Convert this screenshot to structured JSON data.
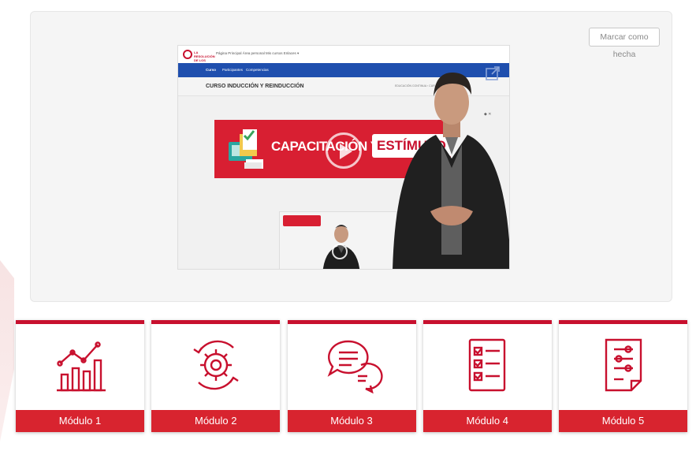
{
  "card": {
    "mark_done_label": "Marcar como hecha"
  },
  "video": {
    "logo_text": "LA RESOLUCIÓN DE LOS LLANOS",
    "top_menu": "Página Principal   Área personal   Mis cursos   Enlaces ▾",
    "nav_items": [
      "Curso",
      "Participantes",
      "Competencias"
    ],
    "course_title": "CURSO INDUCCIÓN Y REINDUCCIÓN",
    "breadcrumb": "EDUCACIÓN CONTINUA  ›  CUR",
    "banner_text_1": "CAPACITACIÓN Y",
    "banner_text_2": "ESTÍMULO"
  },
  "modules": [
    {
      "label": "Módulo 1",
      "icon": "chart-growth-icon"
    },
    {
      "label": "Módulo 2",
      "icon": "gear-cycle-icon"
    },
    {
      "label": "Módulo 3",
      "icon": "chat-bubbles-icon"
    },
    {
      "label": "Módulo 4",
      "icon": "checklist-icon"
    },
    {
      "label": "Módulo 5",
      "icon": "process-document-icon"
    }
  ],
  "colors": {
    "accent": "#c8102e",
    "module_label_bg": "#d8242f",
    "video_nav": "#1f4fae"
  }
}
